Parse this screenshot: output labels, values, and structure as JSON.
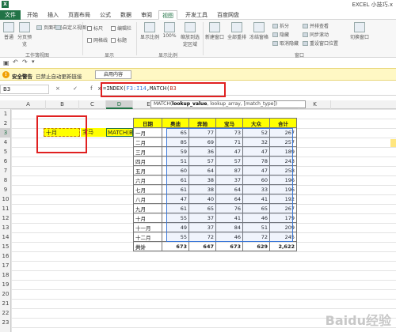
{
  "window": {
    "title": "EXCEL 小技巧.x"
  },
  "tabs": [
    "文件",
    "开始",
    "插入",
    "页面布局",
    "公式",
    "数据",
    "审阅",
    "视图",
    "开发工具",
    "百度网盘"
  ],
  "active_tab": "视图",
  "ribbon": {
    "views": [
      "普通",
      "分页预览",
      "页面布局",
      "自定义视图"
    ],
    "show_checks": [
      "标尺",
      "编辑栏",
      "网格线",
      "标题"
    ],
    "zoom": [
      "显示比例",
      "100%",
      "缩放到选定区域"
    ],
    "window_btns": [
      "新建窗口",
      "全部重排",
      "冻结窗格"
    ],
    "window_small": [
      "拆分",
      "隐藏",
      "取消隐藏",
      "并排查看",
      "同步滚动",
      "重设窗口位置"
    ],
    "switch": "切换窗口",
    "groups": [
      "工作簿视图",
      "显示",
      "显示比例",
      "窗口"
    ]
  },
  "security": {
    "title": "安全警告",
    "message": "已禁止自动更新链接",
    "button": "启用内容"
  },
  "formula_bar": {
    "name_box": "B3",
    "icons": "× ✓ fx",
    "formula_prefix": "=INDEX(",
    "formula_ref": "F3:I14",
    "formula_mid": ",MATCH(",
    "formula_ref2": "B3"
  },
  "tooltip": {
    "func": "MATCH(",
    "arg1": "lookup_value",
    "rest": ", lookup_array, [match_type])"
  },
  "columns": [
    "A",
    "B",
    "C",
    "D",
    "E",
    "F",
    "G",
    "H",
    "I",
    "J",
    "K"
  ],
  "rows": [
    "1",
    "2",
    "3",
    "4",
    "5",
    "6",
    "7",
    "8",
    "9",
    "10",
    "11",
    "12",
    "13",
    "14",
    "15",
    "16",
    "17",
    "18",
    "19",
    "20",
    "21",
    "22",
    "23"
  ],
  "cells": {
    "b3": "十月",
    "c3": "宝马",
    "d3": "MATCH(B3"
  },
  "table": {
    "headers": [
      "日期",
      "奥迪",
      "奔驰",
      "宝马",
      "大众",
      "合计"
    ],
    "rows": [
      [
        "一月",
        "65",
        "77",
        "73",
        "52",
        "267"
      ],
      [
        "二月",
        "85",
        "69",
        "71",
        "32",
        "257"
      ],
      [
        "三月",
        "59",
        "36",
        "47",
        "47",
        "189"
      ],
      [
        "四月",
        "51",
        "57",
        "57",
        "78",
        "243"
      ],
      [
        "五月",
        "60",
        "64",
        "87",
        "47",
        "258"
      ],
      [
        "六月",
        "61",
        "38",
        "37",
        "60",
        "196"
      ],
      [
        "七月",
        "61",
        "38",
        "64",
        "33",
        "196"
      ],
      [
        "八月",
        "47",
        "40",
        "64",
        "41",
        "192"
      ],
      [
        "九月",
        "61",
        "65",
        "76",
        "65",
        "267"
      ],
      [
        "十月",
        "55",
        "37",
        "41",
        "46",
        "179"
      ],
      [
        "十一月",
        "49",
        "37",
        "84",
        "51",
        "209"
      ],
      [
        "十二月",
        "55",
        "72",
        "46",
        "72",
        "245"
      ]
    ],
    "total": [
      "共计",
      "673",
      "647",
      "673",
      "629",
      "2,622"
    ]
  },
  "watermark": "Baidu经验",
  "colors": {
    "excel_green": "#217346",
    "header_yellow": "#ffff00",
    "highlight_red": "#e02020"
  }
}
